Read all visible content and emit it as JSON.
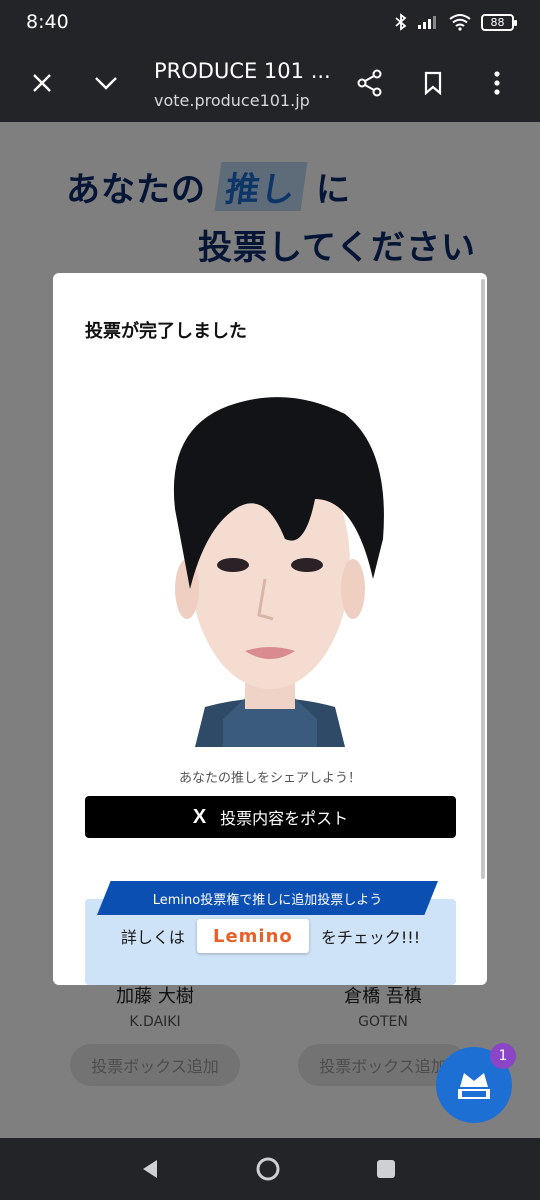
{
  "status": {
    "time": "8:40",
    "battery": "88"
  },
  "browser": {
    "title": "PRODUCE 101 ...",
    "url": "vote.produce101.jp"
  },
  "hero": {
    "line1_prefix": "あなたの",
    "line1_highlight": "推し",
    "line1_suffix": "に",
    "line2": "投票してください"
  },
  "candidates": [
    {
      "name": "加藤 大樹",
      "roman": "K.DAIKI",
      "button": "投票ボックス追加"
    },
    {
      "name": "倉橋 吾槙",
      "roman": "GOTEN",
      "button": "投票ボックス追加"
    }
  ],
  "fab": {
    "badge": "1"
  },
  "modal": {
    "title": "投票が完了しました",
    "share_text": "あなたの推しをシェアしよう！",
    "post_button": "投票内容をポスト",
    "x_icon": "X",
    "lemino_ribbon": "Lemino投票権で推しに追加投票しよう",
    "lemino_prefix": "詳しくは",
    "lemino_logo": "Lemino",
    "lemino_suffix": "をチェック!!!"
  }
}
